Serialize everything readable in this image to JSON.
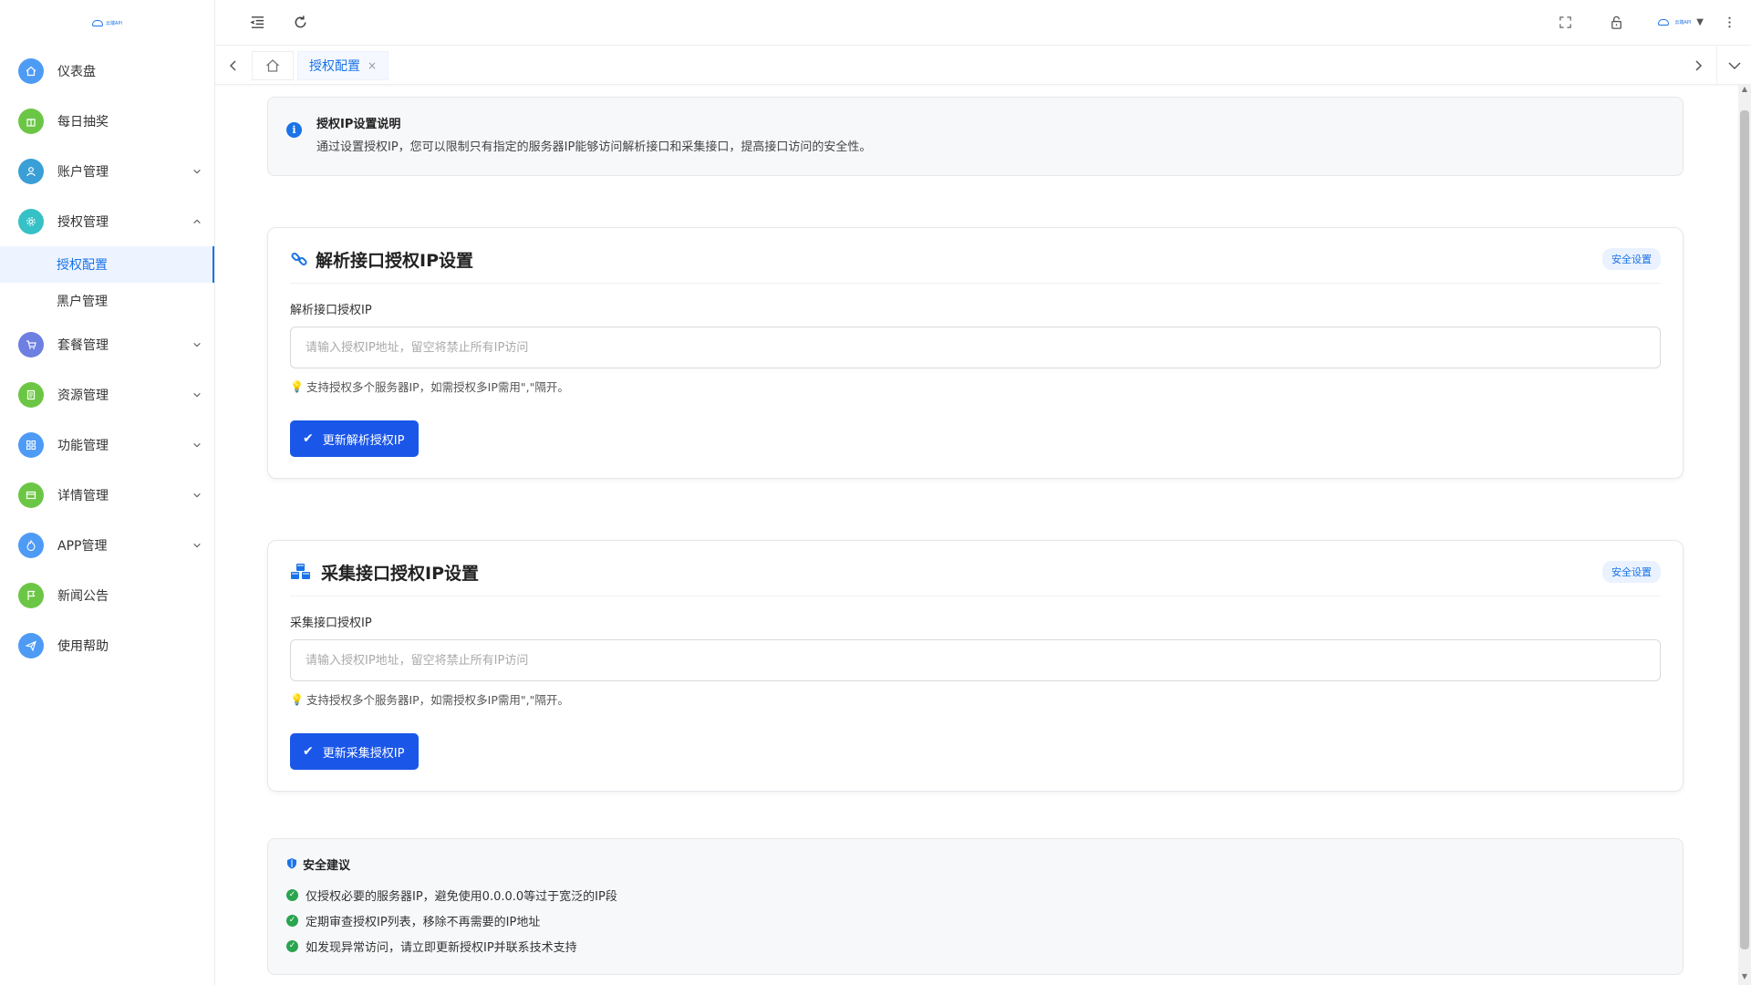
{
  "brand": {
    "logo_text": "云端API"
  },
  "sidebar": {
    "items": [
      {
        "label": "仪表盘",
        "color": "#4e9bf5",
        "icon": "home-icon",
        "expandable": false
      },
      {
        "label": "每日抽奖",
        "color": "#6cc645",
        "icon": "gift-icon",
        "expandable": false
      },
      {
        "label": "账户管理",
        "color": "#3a9fd6",
        "icon": "user-icon",
        "expandable": true
      },
      {
        "label": "授权管理",
        "color": "#35c1c6",
        "icon": "gear-icon",
        "expandable": true,
        "expanded": true
      },
      {
        "label": "套餐管理",
        "color": "#6d7fe0",
        "icon": "cart-icon",
        "expandable": true
      },
      {
        "label": "资源管理",
        "color": "#6cc645",
        "icon": "book-icon",
        "expandable": true
      },
      {
        "label": "功能管理",
        "color": "#4e9bf5",
        "icon": "grid-icon",
        "expandable": true
      },
      {
        "label": "详情管理",
        "color": "#6cc645",
        "icon": "card-icon",
        "expandable": true
      },
      {
        "label": "APP管理",
        "color": "#4e9bf5",
        "icon": "fire-icon",
        "expandable": true
      },
      {
        "label": "新闻公告",
        "color": "#6cc645",
        "icon": "flag-icon",
        "expandable": false
      },
      {
        "label": "使用帮助",
        "color": "#4e9bf5",
        "icon": "send-icon",
        "expandable": false
      }
    ],
    "submenu": [
      {
        "label": "授权配置",
        "active": true
      },
      {
        "label": "黑户管理",
        "active": false
      }
    ]
  },
  "topbar": {
    "user_name": "云端API"
  },
  "tabs": {
    "active_tab": "授权配置",
    "close_glyph": "×"
  },
  "notice": {
    "title": "授权IP设置说明",
    "text": "通过设置授权IP，您可以限制只有指定的服务器IP能够访问解析接口和采集接口，提高接口访问的安全性。"
  },
  "parse_card": {
    "title": "解析接口授权IP设置",
    "badge": "安全设置",
    "field_label": "解析接口授权IP",
    "placeholder": "请输入授权IP地址，留空将禁止所有IP访问",
    "hint": "支持授权多个服务器IP，如需授权多IP需用\",\"隔开。",
    "button": "更新解析授权IP"
  },
  "collect_card": {
    "title": "采集接口授权IP设置",
    "badge": "安全设置",
    "field_label": "采集接口授权IP",
    "placeholder": "请输入授权IP地址，留空将禁止所有IP访问",
    "hint": "支持授权多个服务器IP，如需授权多IP需用\",\"隔开。",
    "button": "更新采集授权IP"
  },
  "security_tips": {
    "title": "安全建议",
    "items": [
      "仅授权必要的服务器IP，避免使用0.0.0.0等过于宽泛的IP段",
      "定期审查授权IP列表，移除不再需要的IP地址",
      "如发现异常访问，请立即更新授权IP并联系技术支持"
    ]
  },
  "colors": {
    "accent": "#1a73e8",
    "button": "#1a56e8",
    "success": "#2aa44f",
    "hint_icon": "#f0a020"
  }
}
